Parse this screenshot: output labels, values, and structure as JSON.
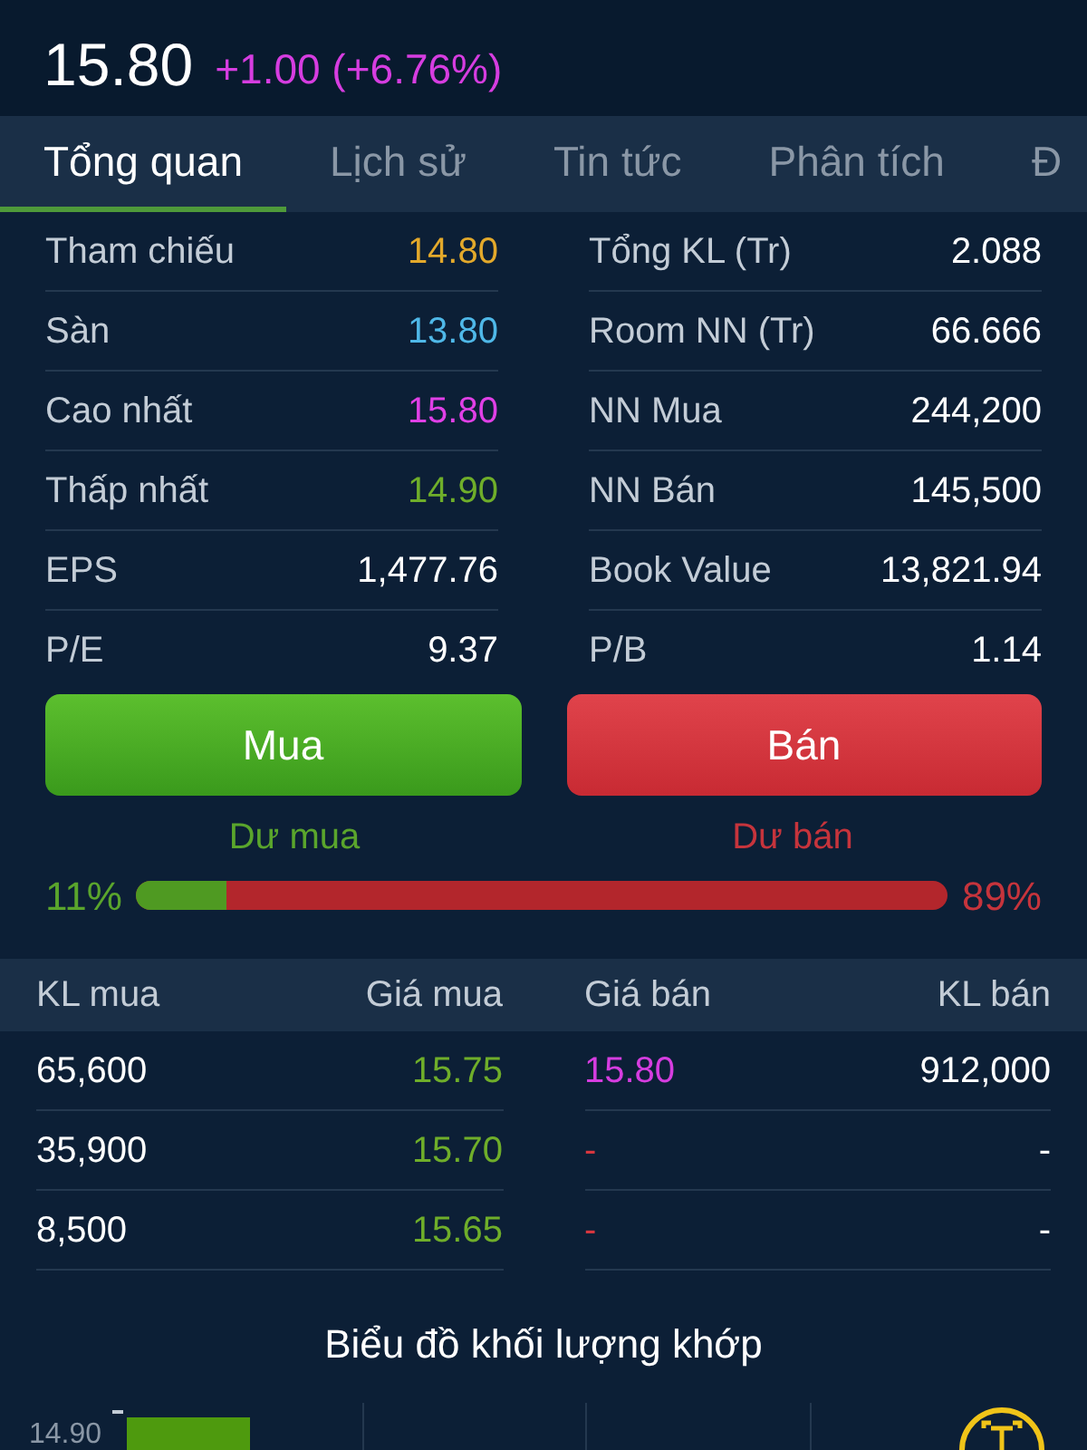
{
  "quote": {
    "price": "15.80",
    "change": "+1.00 (+6.76%)"
  },
  "tabs": [
    {
      "label": "Tổng quan",
      "selected": true
    },
    {
      "label": "Lịch sử",
      "selected": false
    },
    {
      "label": "Tin tức",
      "selected": false
    },
    {
      "label": "Phân tích",
      "selected": false
    },
    {
      "label": "Đ",
      "selected": false
    }
  ],
  "stats": [
    {
      "left_label": "Tham chiếu",
      "left_value": "14.80",
      "color": "#e3a92b",
      "right_label": "Tổng KL (Tr)",
      "right_value": "2.088"
    },
    {
      "left_label": "Sàn",
      "left_value": "13.80",
      "color": "#4fb8e8",
      "right_label": "Room NN (Tr)",
      "right_value": "66.666"
    },
    {
      "left_label": "Cao nhất",
      "left_value": "15.80",
      "color": "#e040e6",
      "right_label": "NN Mua",
      "right_value": "244,200"
    },
    {
      "left_label": "Thấp nhất",
      "left_value": "14.90",
      "color": "#6fae2a",
      "right_label": "NN Bán",
      "right_value": "145,500"
    },
    {
      "left_label": "EPS",
      "left_value": "1,477.76",
      "color": "#ffffff",
      "right_label": "Book Value",
      "right_value": "13,821.94"
    },
    {
      "left_label": "P/E",
      "left_value": "9.37",
      "color": "#ffffff",
      "right_label": "P/B",
      "right_value": "1.14"
    }
  ],
  "buttons": [
    {
      "label": "Mua",
      "kind": "buy"
    },
    {
      "label": "Bán",
      "kind": "sell"
    }
  ],
  "balance": {
    "buy_label": "Dư mua",
    "sell_label": "Dư bán",
    "buy_percent": "11%",
    "sell_percent": "89%",
    "level": 0.11
  },
  "order_book": {
    "columns": [
      "KL mua",
      "Giá mua",
      "Giá bán",
      "KL bán"
    ],
    "rows": [
      {
        "bid_volume": "65,600",
        "bid_price": "15.75",
        "ask_price": "15.80",
        "ask_volume": "912,000"
      },
      {
        "bid_volume": "35,900",
        "bid_price": "15.70",
        "ask_price": "-",
        "ask_volume": "-"
      },
      {
        "bid_volume": "8,500",
        "bid_price": "15.65",
        "ask_price": "-",
        "ask_volume": "-"
      }
    ]
  },
  "chart": {
    "title": "Biểu đồ khối lượng khớp",
    "axis_label": "14.90"
  }
}
